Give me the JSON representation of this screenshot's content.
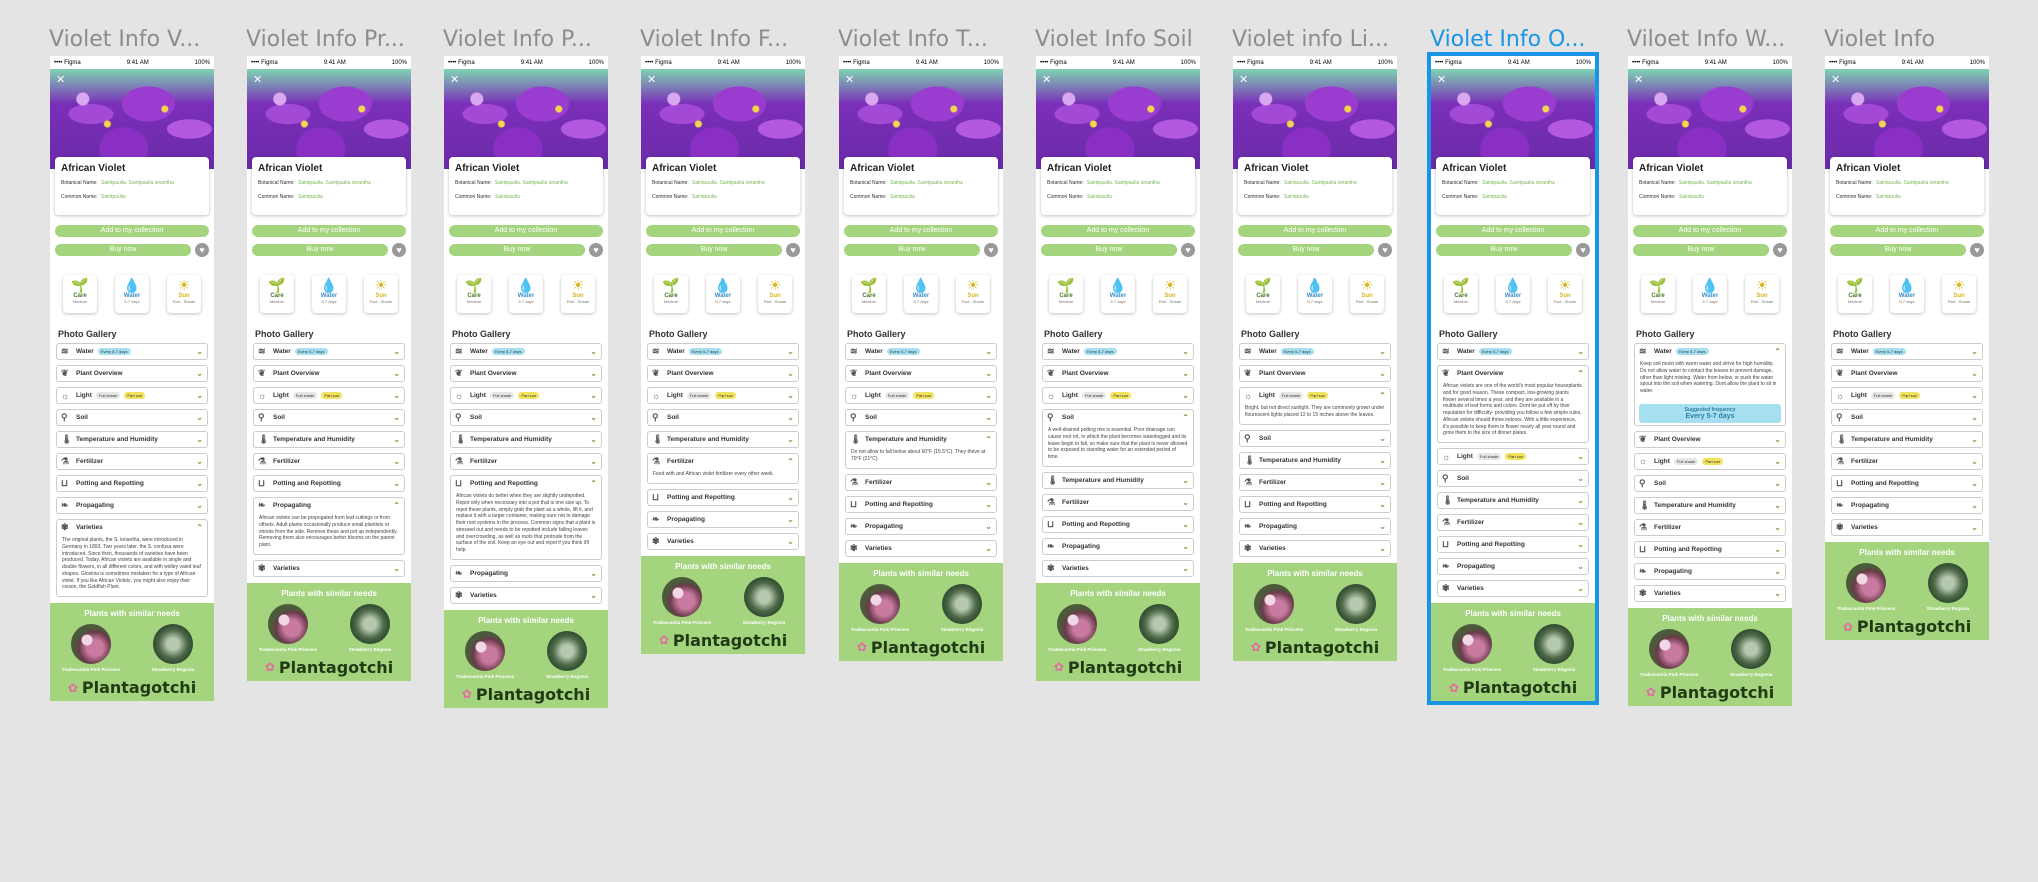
{
  "statusbar": {
    "carrier": "•••• Figma",
    "time": "9:41 AM",
    "battery": "100%"
  },
  "plant": {
    "name": "African Violet",
    "botanical_label": "Botanical Name:",
    "botanical_value": "Saintpaulia, Saintpaulia ionantha",
    "common_label": "Common Name:",
    "common_value": "Saintpaulia"
  },
  "buttons": {
    "add": "Add to my collection",
    "buy": "Buy now"
  },
  "care": [
    {
      "label": "Care",
      "sub": "Medium",
      "icon": "🌱"
    },
    {
      "label": "Water",
      "sub": "5-7 days",
      "icon": "💧"
    },
    {
      "label": "Sun",
      "sub": "Part - Shade",
      "icon": "☀"
    }
  ],
  "gallery_label": "Photo Gallery",
  "sections": {
    "water": "Water",
    "overview": "Plant Overview",
    "light": "Light",
    "soil": "Soil",
    "temp": "Temperature and Humidity",
    "fert": "Fertilizer",
    "pot": "Potting and Repotting",
    "prop": "Propagating",
    "var": "Varieties"
  },
  "tags": {
    "water": "Every 5-7 days",
    "light1": "Full shade",
    "light2": "Part sun"
  },
  "texts": {
    "varieties": "The original plants, the S. ionantha, were introduced in Germany in 1893. Two years later, the S. confusa were introduced. Since then, thousands of varieties have been produced. Today, African violets are available in single and double flowers, in all different colors, and with widley vaied leaf shapes. Gloxinia is sometimes mistaken for a type of African violet. If you like African Violets, you might also enjoy their cousin, the Goldfish Plant.",
    "propagating": "African violets can be propogated from leaf cuttings or from offsets. Adult plants occasionally produce small plantlets or shoots from the side. Remove these and pot up independently. Removing them also encourages better blooms on the parent plant.",
    "potting": "African violets do better when they are slightly undepotted. Repot only when necessary into a pot that is one size up. To repot these plants, simply grab the plant as a whole, lift it, and replace it with a larger container, making sure not to damage their root systems in the process. Common signs that a plant is stressed out and needs to be repotted include falling leaves and overcrowding, as well as roots that protrude from the surface of the soil. Keep an eye out and repot if you think it'll help.",
    "fertilizer": "Feed with and African violet fertilizer every other week.",
    "temp": "Do not allow to fall below about 60°F (15.5°C). They thrive at 70°F (21°C).",
    "soil": "A well-drained potting mix is essential. Poor drainage can cause root rot, in which the plant becomes waterlogged and its leave begin to fall, so make sure that the plant is never allowed to be exposed to standing water for an extended period of time.",
    "light": "Bright, but not direct sunlight. They are commonly grown under flourescent lights placed 12 to 15 inches above the leaves.",
    "overview": "African violets are one of the world's most popular houseplants and for good reason. These compact, low-growing plants flower several times a year, and they are available in a multitude of leaf forms and colors. Dont be put off by their reputation for difficulty- providing you follow a few simple rules, African violets should thrive indoors. With a little experience, it's possible to keep them in flower nearly all year round and grow them to the size of dinner plates.",
    "water": "Keep soil moist with warm water and strive for high humidity. Do not allow water to contact the leaves to prevent damage, other than light misting. Water from below, or push the water spout into the soil when watering. Dont allow the plant to sit in water.",
    "freq_label": "Suggested frequency",
    "freq_value": "Every 5-7 days"
  },
  "similar": {
    "title": "Plants with similar needs",
    "items": [
      "Tradescantia Pink Princess",
      "Strawberry Begonia"
    ]
  },
  "brand": "Plantagotchi",
  "frames": [
    {
      "title": "Violet Info V...",
      "open": "var"
    },
    {
      "title": "Violet Info Pr...",
      "open": "prop"
    },
    {
      "title": "Violet Info P...",
      "open": "pot"
    },
    {
      "title": "Violet Info F...",
      "open": "fert"
    },
    {
      "title": "Violet Info T...",
      "open": "temp"
    },
    {
      "title": "Violet Info Soil",
      "open": "soil"
    },
    {
      "title": "Violet info Li...",
      "open": "light"
    },
    {
      "title": "Violet Info O...",
      "open": "overview",
      "selected": true
    },
    {
      "title": "Viloet Info W...",
      "open": "water"
    },
    {
      "title": "Violet Info",
      "open": ""
    }
  ]
}
